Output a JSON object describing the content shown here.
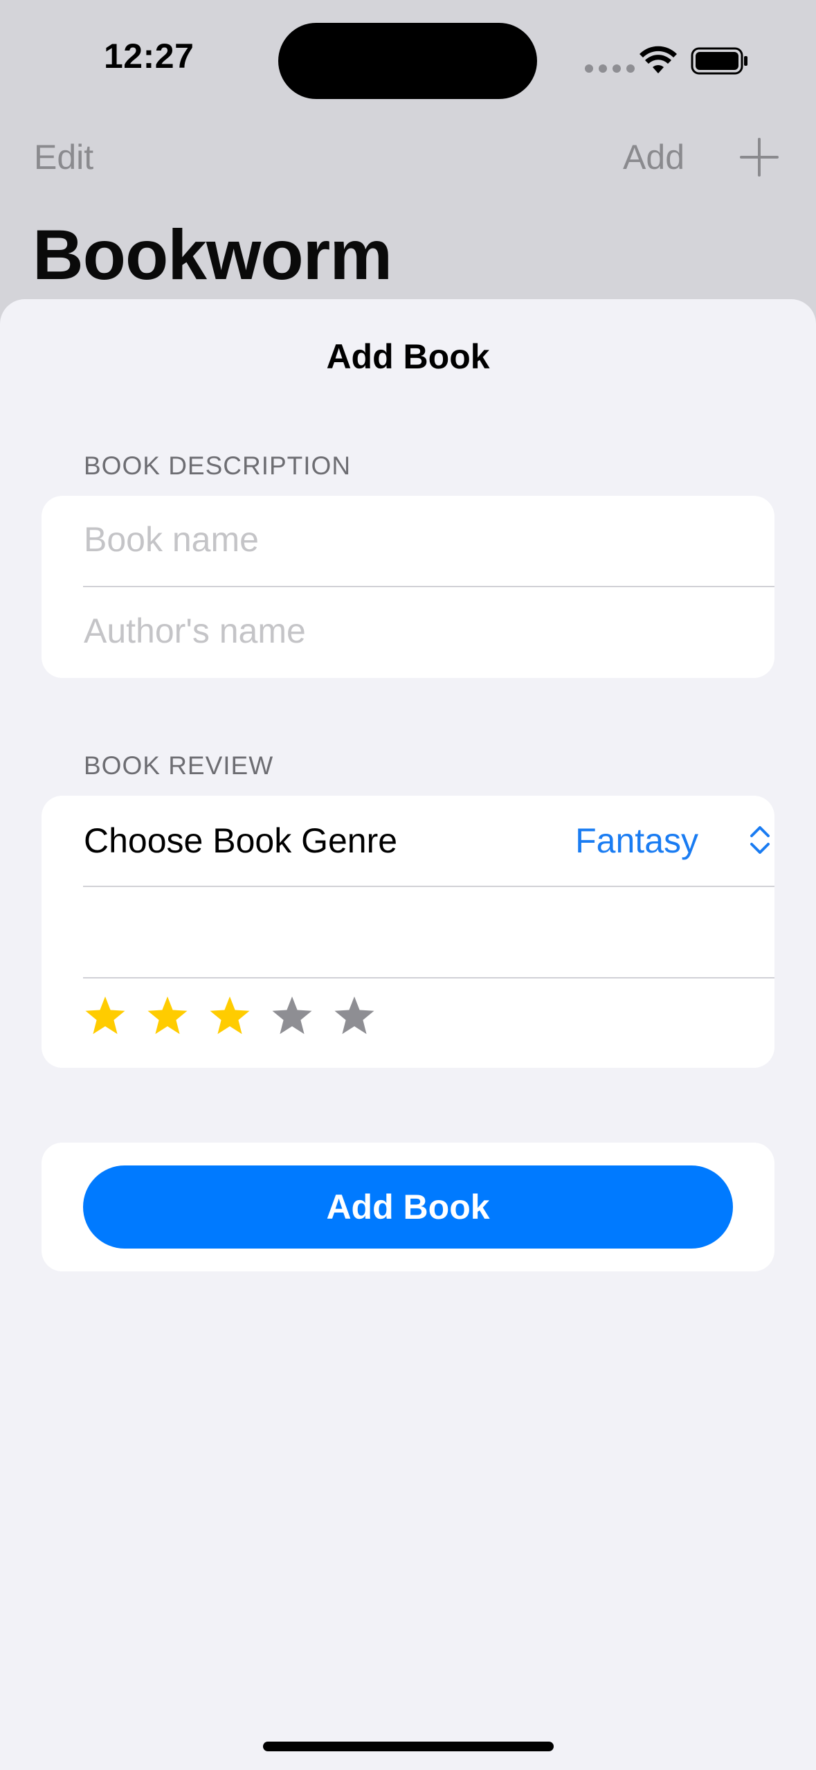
{
  "status_bar": {
    "time": "12:27"
  },
  "background_nav": {
    "edit_label": "Edit",
    "add_label": "Add",
    "title": "Bookworm"
  },
  "sheet": {
    "title": "Add Book",
    "description_section": {
      "header": "BOOK DESCRIPTION",
      "book_name_placeholder": "Book name",
      "book_name_value": "",
      "author_placeholder": "Author's name",
      "author_value": ""
    },
    "review_section": {
      "header": "BOOK REVIEW",
      "genre_label": "Choose Book Genre",
      "genre_value": "Fantasy",
      "review_text": "",
      "rating": 3,
      "rating_max": 5
    },
    "add_button_label": "Add Book"
  },
  "colors": {
    "accent": "#007aff",
    "star_filled": "#ffcc00",
    "star_empty": "#8e8e93"
  },
  "icons": {
    "wifi": "wifi-icon",
    "battery": "battery-icon",
    "plus": "plus-icon",
    "genre_picker": "chevron-up-down-icon",
    "rating": "star-icon"
  }
}
